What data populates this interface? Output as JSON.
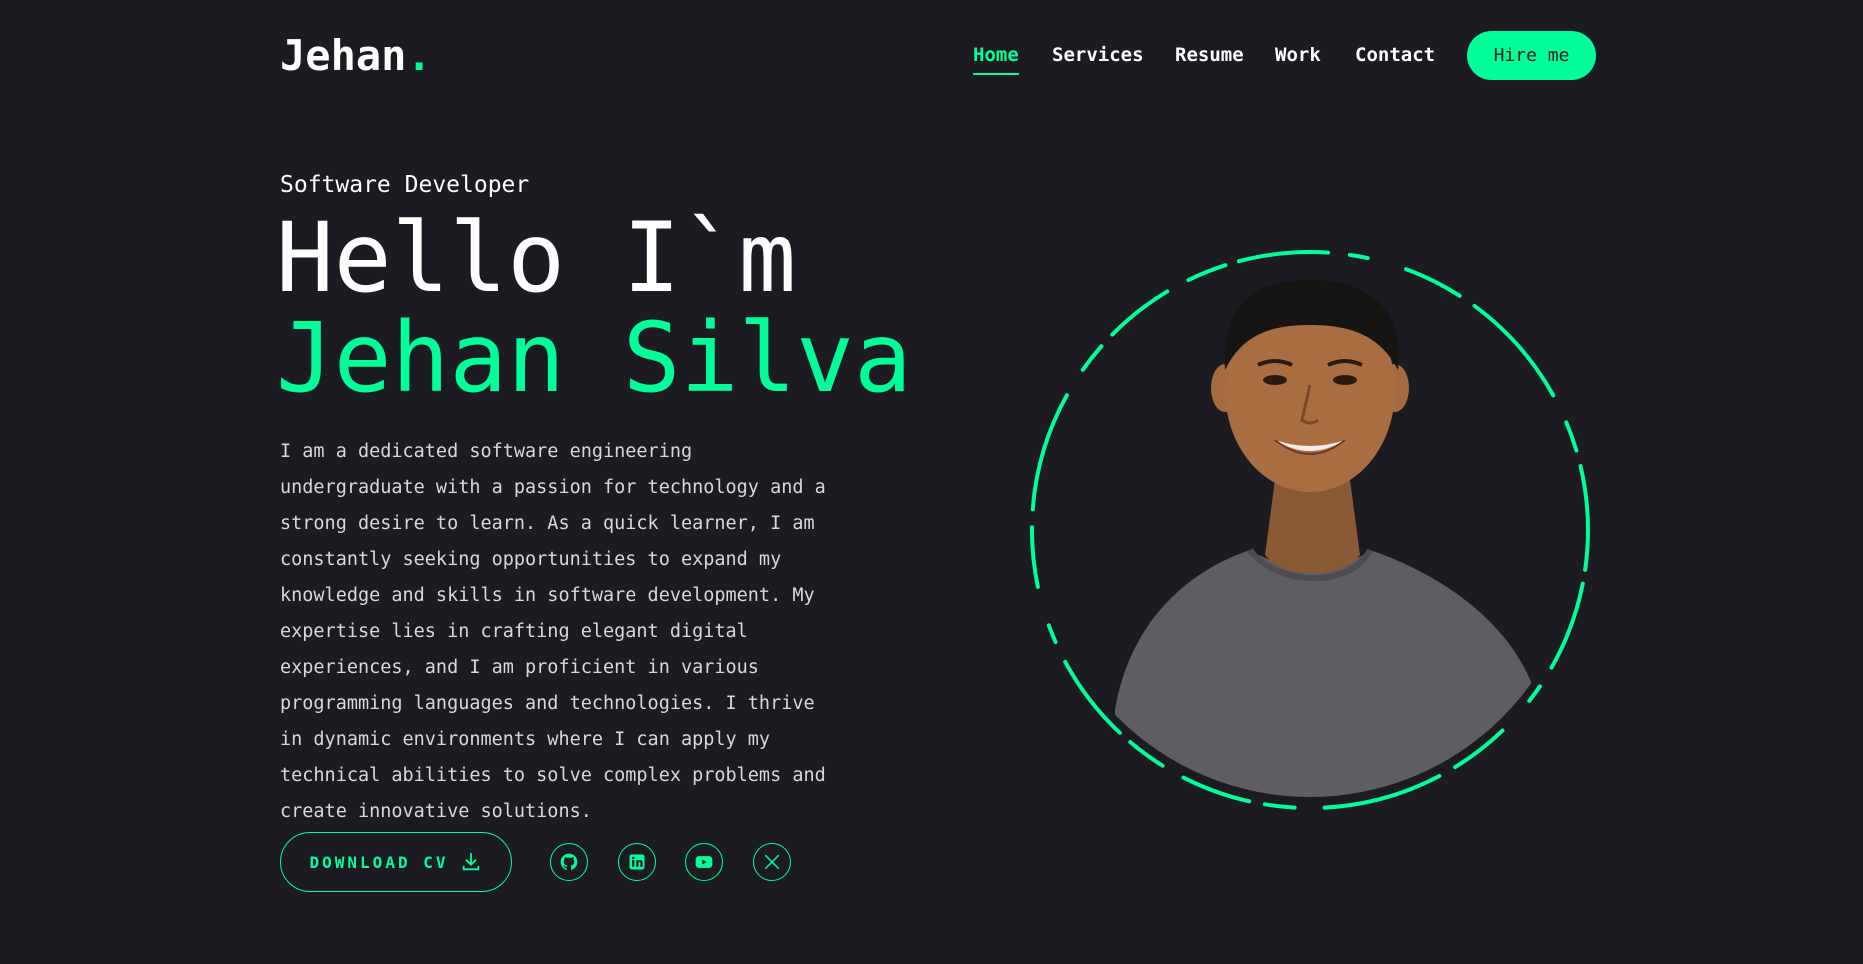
{
  "header": {
    "logo_text": "Jehan",
    "logo_dot": ".",
    "nav": [
      {
        "label": "Home",
        "active": true
      },
      {
        "label": "Services",
        "active": false
      },
      {
        "label": "Resume",
        "active": false
      },
      {
        "label": "Work",
        "active": false
      },
      {
        "label": "Contact",
        "active": false
      }
    ],
    "hire_label": "Hire me"
  },
  "hero": {
    "role": "Software Developer",
    "greeting": "Hello I`m",
    "name": "Jehan Silva",
    "bio": "I am a dedicated software engineering undergraduate with a passion for technology and a strong desire to learn. As a quick learner, I am constantly seeking opportunities to expand my knowledge and skills in software development. My expertise lies in crafting elegant digital experiences, and I am proficient in various programming languages and technologies. I thrive in dynamic environments where I can apply my technical abilities to solve complex problems and create innovative solutions.",
    "download_label": "DOWNLOAD CV",
    "download_icon": "download-icon",
    "socials": [
      {
        "name": "github",
        "icon": "github-icon"
      },
      {
        "name": "linkedin",
        "icon": "linkedin-icon"
      },
      {
        "name": "youtube",
        "icon": "youtube-icon"
      },
      {
        "name": "x",
        "icon": "x-icon"
      }
    ]
  },
  "colors": {
    "background": "#1c1b22",
    "accent": "#00ff99",
    "text": "#ffffff"
  }
}
